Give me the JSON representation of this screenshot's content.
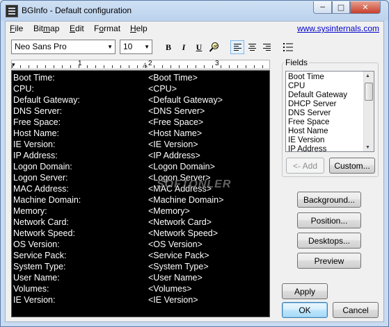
{
  "window": {
    "title": "BGInfo - Default configuration",
    "min_glyph": "─",
    "max_glyph": "□",
    "close_glyph": "✕"
  },
  "menu": {
    "file": {
      "u": "F",
      "rest": "ile"
    },
    "bitmap": {
      "pre": "Bit",
      "u": "m",
      "rest": "ap"
    },
    "edit": {
      "u": "E",
      "rest": "dit"
    },
    "format": {
      "pre": "F",
      "u": "o",
      "rest": "rmat"
    },
    "help": {
      "u": "H",
      "rest": "elp"
    },
    "link": "www.sysinternals.com"
  },
  "toolbar": {
    "font": "Neo Sans Pro",
    "size": "10",
    "bold": "B",
    "italic": "I",
    "underline": "U",
    "dropdown_arrow": "▼",
    "align_active": "left"
  },
  "ruler": {
    "numbers": [
      "1",
      "2",
      "3"
    ]
  },
  "editor": {
    "rows": [
      {
        "label": "Boot Time:",
        "value": "<Boot Time>"
      },
      {
        "label": "CPU:",
        "value": "<CPU>"
      },
      {
        "label": "Default Gateway:",
        "value": "<Default Gateway>"
      },
      {
        "label": "DNS Server:",
        "value": "<DNS Server>"
      },
      {
        "label": "Free Space:",
        "value": "<Free Space>"
      },
      {
        "label": "Host Name:",
        "value": "<Host Name>"
      },
      {
        "label": "IE Version:",
        "value": "<IE Version>"
      },
      {
        "label": "IP Address:",
        "value": "<IP Address>"
      },
      {
        "label": "Logon Domain:",
        "value": "<Logon Domain>"
      },
      {
        "label": "Logon Server:",
        "value": "<Logon Server>"
      },
      {
        "label": "MAC Address:",
        "value": "<MAC Address>"
      },
      {
        "label": "Machine Domain:",
        "value": "<Machine Domain>"
      },
      {
        "label": "Memory:",
        "value": "<Memory>"
      },
      {
        "label": "Network Card:",
        "value": "<Network Card>"
      },
      {
        "label": "Network Speed:",
        "value": "<Network Speed>"
      },
      {
        "label": "OS Version:",
        "value": "<OS Version>"
      },
      {
        "label": "Service Pack:",
        "value": "<Service Pack>"
      },
      {
        "label": "System Type:",
        "value": "<System Type>"
      },
      {
        "label": "User Name:",
        "value": "<User Name>"
      },
      {
        "label": "Volumes:",
        "value": "<Volumes>"
      },
      {
        "label": "IE Version:",
        "value": "<IE Version>"
      }
    ],
    "watermark": "SOFTONLER"
  },
  "fields": {
    "label": "Fields",
    "items": [
      "Boot Time",
      "CPU",
      "Default Gateway",
      "DHCP Server",
      "DNS Server",
      "Free Space",
      "Host Name",
      "IE Version",
      "IP Address"
    ],
    "add_button": "<- Add",
    "custom_button": "Custom..."
  },
  "buttons": {
    "background": "Background...",
    "position": "Position...",
    "desktops": "Desktops...",
    "preview": "Preview",
    "apply": "Apply",
    "ok": "OK",
    "cancel": "Cancel"
  }
}
